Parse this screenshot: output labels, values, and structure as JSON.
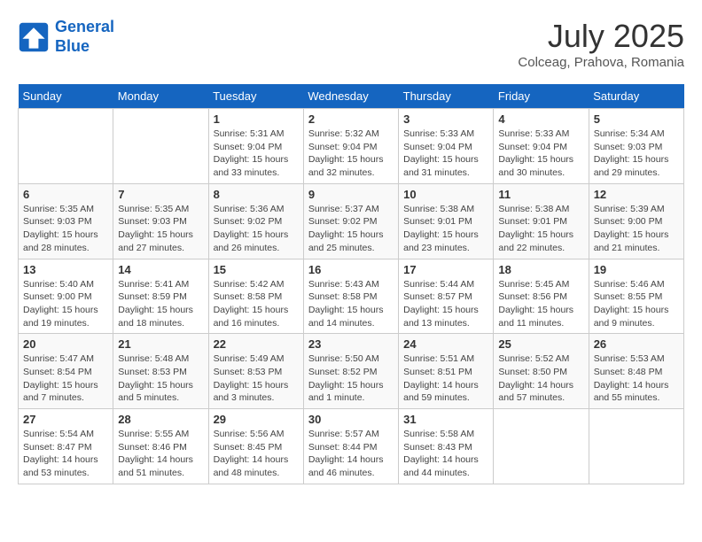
{
  "header": {
    "logo_line1": "General",
    "logo_line2": "Blue",
    "month": "July 2025",
    "location": "Colceag, Prahova, Romania"
  },
  "days_of_week": [
    "Sunday",
    "Monday",
    "Tuesday",
    "Wednesday",
    "Thursday",
    "Friday",
    "Saturday"
  ],
  "weeks": [
    [
      {
        "day": "",
        "info": ""
      },
      {
        "day": "",
        "info": ""
      },
      {
        "day": "1",
        "info": "Sunrise: 5:31 AM\nSunset: 9:04 PM\nDaylight: 15 hours and 33 minutes."
      },
      {
        "day": "2",
        "info": "Sunrise: 5:32 AM\nSunset: 9:04 PM\nDaylight: 15 hours and 32 minutes."
      },
      {
        "day": "3",
        "info": "Sunrise: 5:33 AM\nSunset: 9:04 PM\nDaylight: 15 hours and 31 minutes."
      },
      {
        "day": "4",
        "info": "Sunrise: 5:33 AM\nSunset: 9:04 PM\nDaylight: 15 hours and 30 minutes."
      },
      {
        "day": "5",
        "info": "Sunrise: 5:34 AM\nSunset: 9:03 PM\nDaylight: 15 hours and 29 minutes."
      }
    ],
    [
      {
        "day": "6",
        "info": "Sunrise: 5:35 AM\nSunset: 9:03 PM\nDaylight: 15 hours and 28 minutes."
      },
      {
        "day": "7",
        "info": "Sunrise: 5:35 AM\nSunset: 9:03 PM\nDaylight: 15 hours and 27 minutes."
      },
      {
        "day": "8",
        "info": "Sunrise: 5:36 AM\nSunset: 9:02 PM\nDaylight: 15 hours and 26 minutes."
      },
      {
        "day": "9",
        "info": "Sunrise: 5:37 AM\nSunset: 9:02 PM\nDaylight: 15 hours and 25 minutes."
      },
      {
        "day": "10",
        "info": "Sunrise: 5:38 AM\nSunset: 9:01 PM\nDaylight: 15 hours and 23 minutes."
      },
      {
        "day": "11",
        "info": "Sunrise: 5:38 AM\nSunset: 9:01 PM\nDaylight: 15 hours and 22 minutes."
      },
      {
        "day": "12",
        "info": "Sunrise: 5:39 AM\nSunset: 9:00 PM\nDaylight: 15 hours and 21 minutes."
      }
    ],
    [
      {
        "day": "13",
        "info": "Sunrise: 5:40 AM\nSunset: 9:00 PM\nDaylight: 15 hours and 19 minutes."
      },
      {
        "day": "14",
        "info": "Sunrise: 5:41 AM\nSunset: 8:59 PM\nDaylight: 15 hours and 18 minutes."
      },
      {
        "day": "15",
        "info": "Sunrise: 5:42 AM\nSunset: 8:58 PM\nDaylight: 15 hours and 16 minutes."
      },
      {
        "day": "16",
        "info": "Sunrise: 5:43 AM\nSunset: 8:58 PM\nDaylight: 15 hours and 14 minutes."
      },
      {
        "day": "17",
        "info": "Sunrise: 5:44 AM\nSunset: 8:57 PM\nDaylight: 15 hours and 13 minutes."
      },
      {
        "day": "18",
        "info": "Sunrise: 5:45 AM\nSunset: 8:56 PM\nDaylight: 15 hours and 11 minutes."
      },
      {
        "day": "19",
        "info": "Sunrise: 5:46 AM\nSunset: 8:55 PM\nDaylight: 15 hours and 9 minutes."
      }
    ],
    [
      {
        "day": "20",
        "info": "Sunrise: 5:47 AM\nSunset: 8:54 PM\nDaylight: 15 hours and 7 minutes."
      },
      {
        "day": "21",
        "info": "Sunrise: 5:48 AM\nSunset: 8:53 PM\nDaylight: 15 hours and 5 minutes."
      },
      {
        "day": "22",
        "info": "Sunrise: 5:49 AM\nSunset: 8:53 PM\nDaylight: 15 hours and 3 minutes."
      },
      {
        "day": "23",
        "info": "Sunrise: 5:50 AM\nSunset: 8:52 PM\nDaylight: 15 hours and 1 minute."
      },
      {
        "day": "24",
        "info": "Sunrise: 5:51 AM\nSunset: 8:51 PM\nDaylight: 14 hours and 59 minutes."
      },
      {
        "day": "25",
        "info": "Sunrise: 5:52 AM\nSunset: 8:50 PM\nDaylight: 14 hours and 57 minutes."
      },
      {
        "day": "26",
        "info": "Sunrise: 5:53 AM\nSunset: 8:48 PM\nDaylight: 14 hours and 55 minutes."
      }
    ],
    [
      {
        "day": "27",
        "info": "Sunrise: 5:54 AM\nSunset: 8:47 PM\nDaylight: 14 hours and 53 minutes."
      },
      {
        "day": "28",
        "info": "Sunrise: 5:55 AM\nSunset: 8:46 PM\nDaylight: 14 hours and 51 minutes."
      },
      {
        "day": "29",
        "info": "Sunrise: 5:56 AM\nSunset: 8:45 PM\nDaylight: 14 hours and 48 minutes."
      },
      {
        "day": "30",
        "info": "Sunrise: 5:57 AM\nSunset: 8:44 PM\nDaylight: 14 hours and 46 minutes."
      },
      {
        "day": "31",
        "info": "Sunrise: 5:58 AM\nSunset: 8:43 PM\nDaylight: 14 hours and 44 minutes."
      },
      {
        "day": "",
        "info": ""
      },
      {
        "day": "",
        "info": ""
      }
    ]
  ]
}
